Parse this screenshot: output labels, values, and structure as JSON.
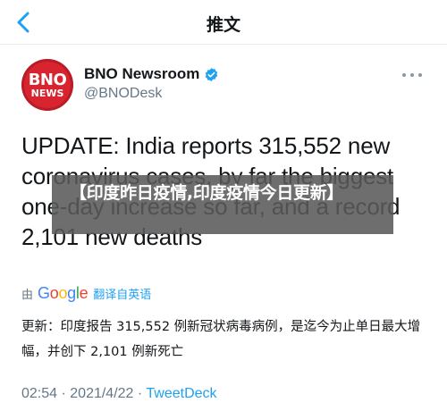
{
  "nav": {
    "title": "推文"
  },
  "author": {
    "avatar_line1": "BNO",
    "avatar_line2": "NEWS",
    "display_name": "BNO Newsroom",
    "handle": "@BNODesk"
  },
  "tweet": {
    "text": "UPDATE: India reports 315,552 new coronavirus cases, by far the biggest one-day increase so far, and a record 2,101 new deaths"
  },
  "overlay": {
    "text": "【印度昨日疫情,印度疫情今日更新】"
  },
  "translation": {
    "by": "由",
    "google": [
      "G",
      "o",
      "o",
      "g",
      "l",
      "e"
    ],
    "link": "翻译自英语",
    "text": "更新：印度报告 315,552 例新冠状病毒病例，是迄今为止单日最大增幅，并创下 2,101 例新死亡"
  },
  "meta": {
    "time": "02:54",
    "sep1": " · ",
    "date": "2021/4/22",
    "sep2": " · ",
    "source": "TweetDeck"
  },
  "colors": {
    "accent": "#1da1f2",
    "brand_red": "#d7242f",
    "google": [
      "#4285f4",
      "#ea4335",
      "#fbbc05",
      "#4285f4",
      "#34a853",
      "#ea4335"
    ]
  },
  "icons": {
    "back": "chevron-left-icon",
    "verified": "verified-badge-icon",
    "more": "more-options-icon"
  }
}
